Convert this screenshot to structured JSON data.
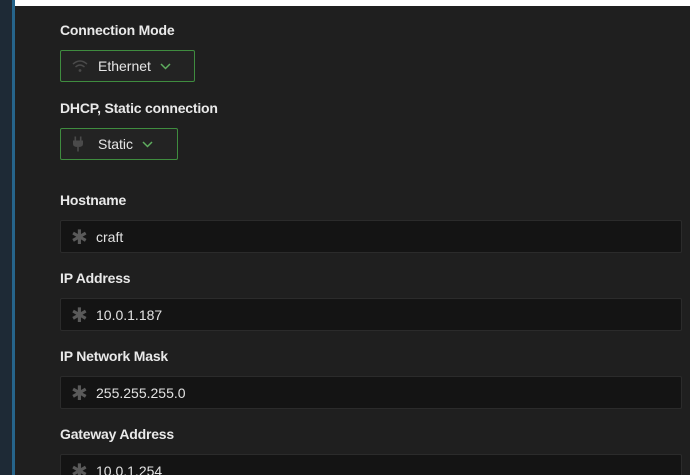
{
  "settings": {
    "connection_mode": {
      "label": "Connection Mode",
      "selected": "Ethernet",
      "icon": "wifi-icon"
    },
    "dhcp_static": {
      "label": "DHCP, Static connection",
      "selected": "Static",
      "icon": "plug-icon"
    },
    "hostname": {
      "label": "Hostname",
      "value": "craft"
    },
    "ip_address": {
      "label": "IP Address",
      "value": "10.0.1.187"
    },
    "network_mask": {
      "label": "IP Network Mask",
      "value": "255.255.255.0"
    },
    "gateway": {
      "label": "Gateway Address",
      "value": "10.0.1.254"
    }
  },
  "colors": {
    "panel_bg": "#1f1f1f",
    "field_bg": "#141414",
    "select_border": "#3f8c3f",
    "accent_blue": "#26648a",
    "label_text": "#e9e9e9"
  }
}
